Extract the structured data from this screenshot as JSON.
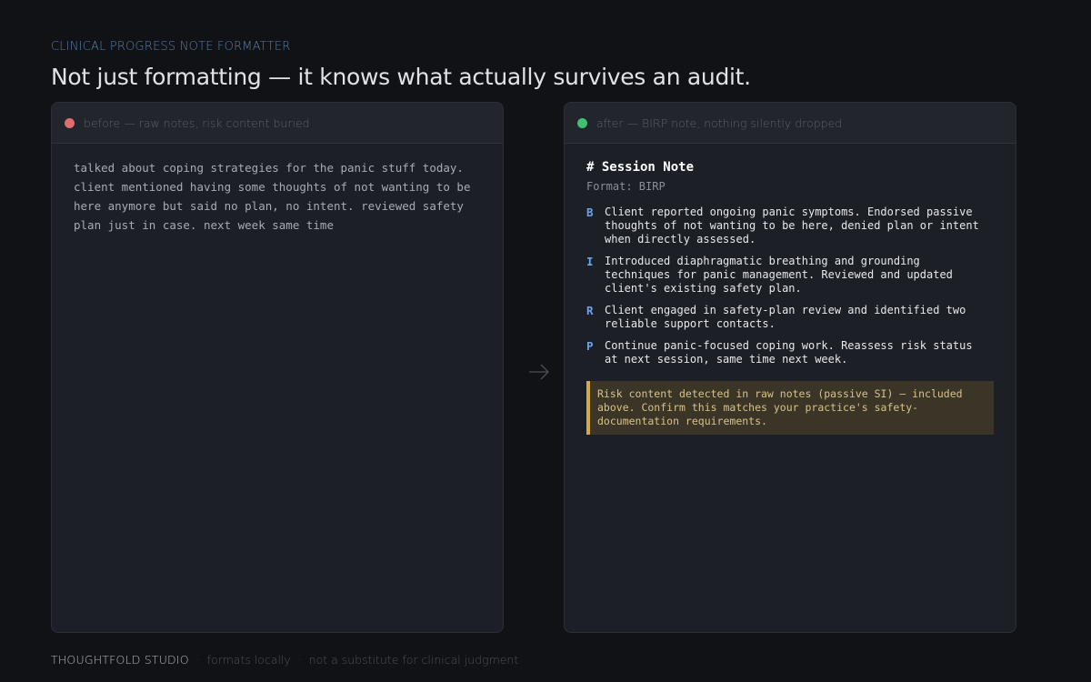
{
  "header": {
    "eyebrow": "Clinical Progress Note Formatter",
    "headline": "Not just formatting — it knows what actually survives an audit."
  },
  "before_panel": {
    "title": "before — raw notes, risk content buried",
    "dot_color": "#e06c70",
    "raw_notes": "talked about coping strategies for the panic stuff today.\nclient mentioned having some thoughts of not wanting to be\nhere anymore but said no plan, no intent. reviewed safety\nplan just in case. next week same time"
  },
  "after_panel": {
    "title": "after — BIRP note, nothing silently dropped",
    "dot_color": "#3fbf6f",
    "note_title": "# Session Note",
    "format_line": "Format: BIRP",
    "items": [
      {
        "letter": "B",
        "text": "Client reported ongoing panic symptoms. Endorsed passive thoughts of not wanting to be here, denied plan or intent when directly assessed."
      },
      {
        "letter": "I",
        "text": "Introduced diaphragmatic breathing and grounding techniques for panic management. Reviewed and updated client's existing safety plan."
      },
      {
        "letter": "R",
        "text": "Client engaged in safety-plan review and identified two reliable support contacts."
      },
      {
        "letter": "P",
        "text": "Continue panic-focused coping work. Reassess risk status at next session, same time next week."
      }
    ],
    "risk_alert": "Risk content detected in raw notes (passive SI) — included above. Confirm this matches your practice's safety-documentation requirements."
  },
  "footer": {
    "brand": "Thoughtfold Studio",
    "separator": "·",
    "note1": "formats locally",
    "note2": "not a substitute for clinical judgment"
  },
  "icons": {
    "transform_arrow": "arrow-right-icon"
  },
  "colors": {
    "accent_blue": "#6fa3e8",
    "warning_amber": "#d3a94a",
    "background": "#111216"
  }
}
